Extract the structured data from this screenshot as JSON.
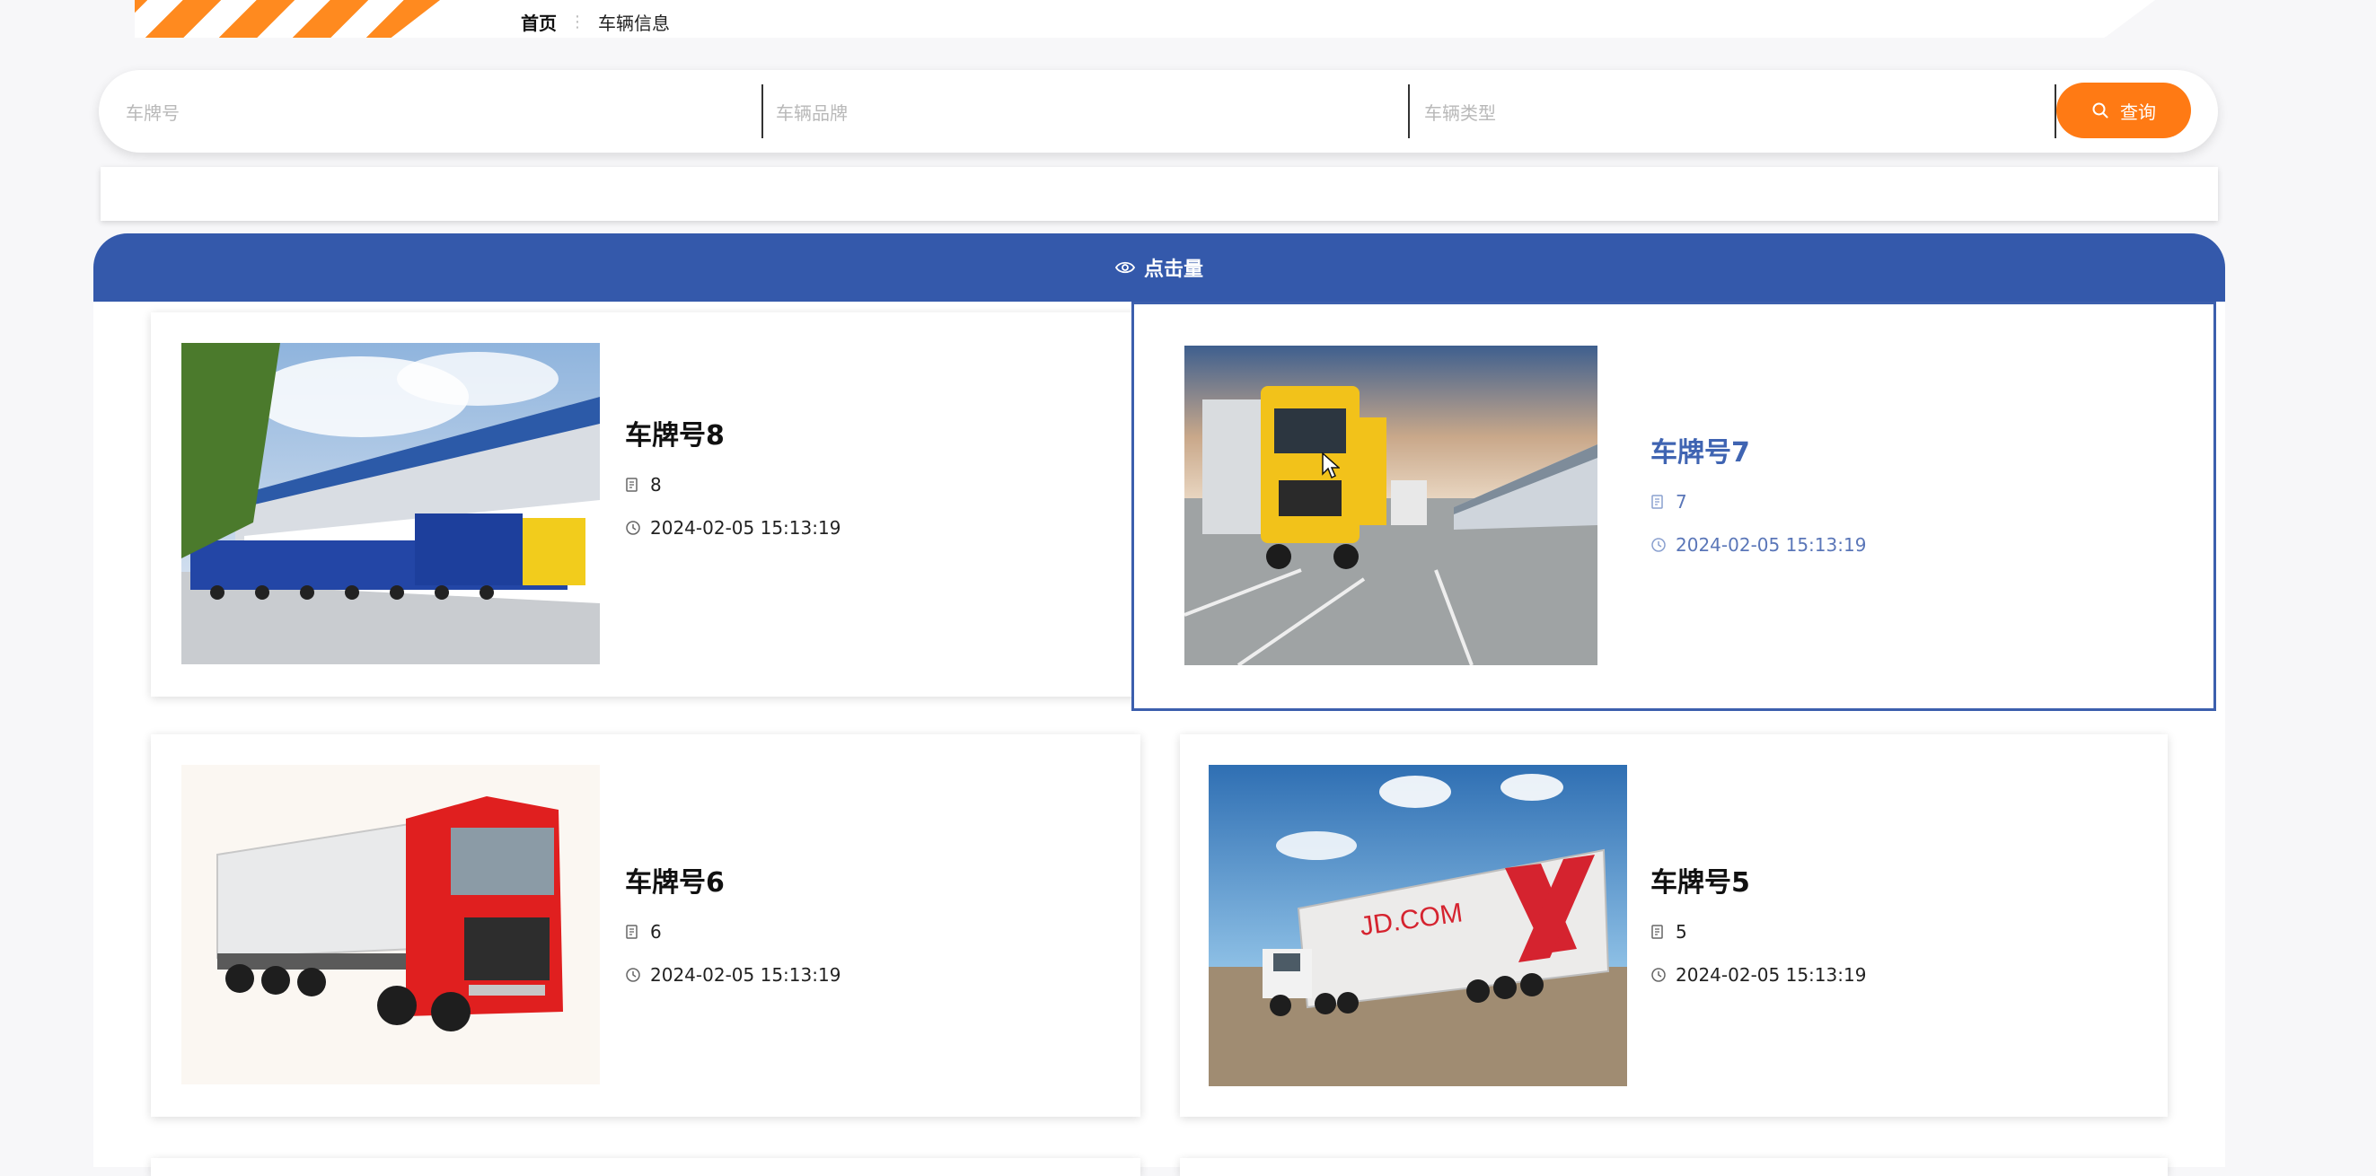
{
  "breadcrumb": {
    "home": "首页",
    "separator": "⋮",
    "current": "车辆信息"
  },
  "search": {
    "fields": [
      {
        "placeholder": "车牌号"
      },
      {
        "placeholder": "车辆品牌"
      },
      {
        "placeholder": "车辆类型"
      }
    ],
    "button_label": "查询"
  },
  "list": {
    "header_label": "点击量",
    "cards": [
      {
        "title": "车牌号8",
        "count": "8",
        "date": "2024-02-05 15:13:19",
        "image": "warehouse-blue-trucks"
      },
      {
        "title": "车牌号7",
        "count": "7",
        "date": "2024-02-05 15:13:19",
        "image": "yellow-truck-depot"
      },
      {
        "title": "车牌号6",
        "count": "6",
        "date": "2024-02-05 15:13:19",
        "image": "red-truck"
      },
      {
        "title": "车牌号5",
        "count": "5",
        "date": "2024-02-05 15:13:19",
        "image": "jd-truck",
        "image_text": "JD.COM"
      }
    ]
  },
  "colors": {
    "accent_orange": "#ff7a14",
    "header_blue": "#3459ab",
    "active_blue": "#3f64b2"
  },
  "icons": {
    "search": "search-icon",
    "views": "eye-icon",
    "count": "document-icon",
    "date": "clock-icon"
  }
}
